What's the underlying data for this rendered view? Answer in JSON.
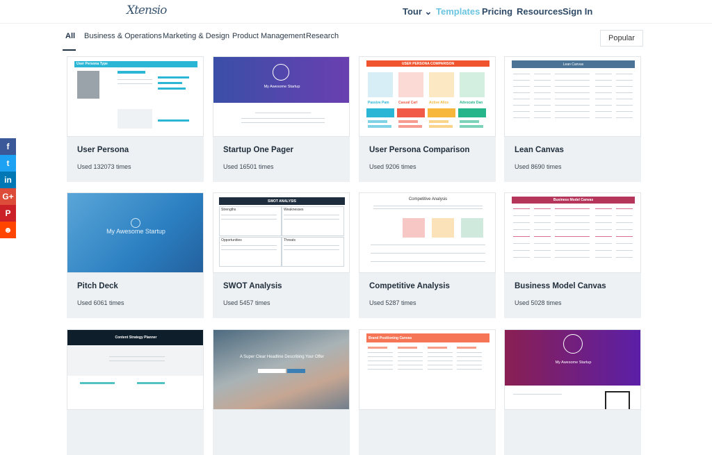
{
  "header": {
    "logo": "Xtensio",
    "nav": [
      {
        "label": "Tour ⌄"
      },
      {
        "label": "Templates",
        "active": true
      },
      {
        "label": "Pricing"
      },
      {
        "label": "Resources"
      },
      {
        "label": "Sign In"
      }
    ]
  },
  "filters": {
    "tabs": [
      {
        "label": "All",
        "active": true
      },
      {
        "label": "Business & Operations"
      },
      {
        "label": "Marketing & Design"
      },
      {
        "label": "Product Management"
      },
      {
        "label": "Research"
      }
    ],
    "sort": "Popular"
  },
  "social": [
    {
      "icon": "facebook-icon",
      "glyph": "f",
      "color": "#3b5998"
    },
    {
      "icon": "twitter-icon",
      "glyph": "t",
      "color": "#1da1f2"
    },
    {
      "icon": "linkedin-icon",
      "glyph": "in",
      "color": "#0077b5"
    },
    {
      "icon": "google-plus-icon",
      "glyph": "G+",
      "color": "#dd4b39"
    },
    {
      "icon": "pinterest-icon",
      "glyph": "P",
      "color": "#cb2027"
    },
    {
      "icon": "reddit-icon",
      "glyph": "☻",
      "color": "#ff4500"
    }
  ],
  "templates": [
    {
      "title": "User Persona",
      "used": "Used 132073 times",
      "thumb": "User Persona Type"
    },
    {
      "title": "Startup One Pager",
      "used": "Used 16501 times",
      "thumb": "My Awesome Startup"
    },
    {
      "title": "User Persona Comparison",
      "used": "Used 9206 times",
      "thumb": "USER PERSONA COMPARISON",
      "names": [
        "Passive Pam",
        "Casual Carl",
        "Active Alice",
        "Advocate Dan"
      ]
    },
    {
      "title": "Lean Canvas",
      "used": "Used 8690 times",
      "thumb": "Lean Canvas"
    },
    {
      "title": "Pitch Deck",
      "used": "Used 6061 times",
      "thumb": "My Awesome Startup"
    },
    {
      "title": "SWOT Analysis",
      "used": "Used 5457 times",
      "thumb": "SWOT ANALYSIS",
      "quads": [
        "Strengths",
        "Weaknesses",
        "Opportunities",
        "Threats"
      ]
    },
    {
      "title": "Competitive Analysis",
      "used": "Used 5287 times",
      "thumb": "Competitive Analysis"
    },
    {
      "title": "Business Model Canvas",
      "used": "Used 5028 times",
      "thumb": "Business Model Canvas"
    },
    {
      "title": "",
      "used": "",
      "thumb": "Content Strategy Planner"
    },
    {
      "title": "",
      "used": "",
      "thumb": "A Super Clear Headline Describing Your Offer"
    },
    {
      "title": "",
      "used": "",
      "thumb": "Brand Positioning Canvas"
    },
    {
      "title": "",
      "used": "",
      "thumb": "My Awesome Startup"
    }
  ]
}
